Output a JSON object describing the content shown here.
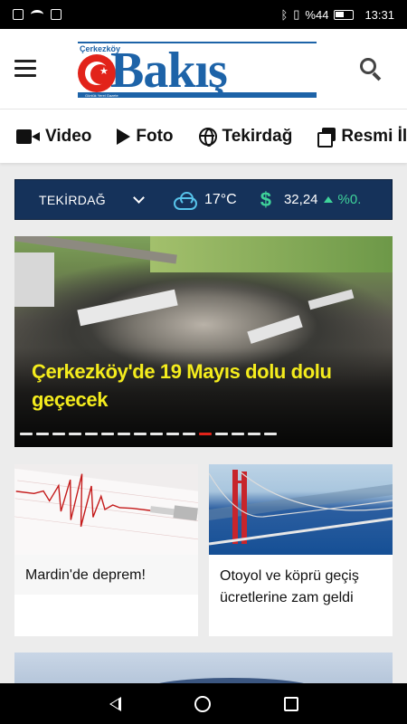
{
  "status_bar": {
    "network_icons": [
      "sim-icon",
      "wifi-icon",
      "nfc-icon"
    ],
    "right_icons": [
      "bluetooth-icon",
      "vibrate-icon"
    ],
    "signal": "%44",
    "time": "13:31"
  },
  "header": {
    "logo": {
      "small_text": "Çerkezköy",
      "name": "Bakış",
      "tagline": "Günlük Yerel Gazete",
      "brand_color": "#1d63a8",
      "accent_color": "#e2231a"
    }
  },
  "categories": [
    {
      "label": "Video",
      "icon": "video-icon"
    },
    {
      "label": "Foto",
      "icon": "play-icon"
    },
    {
      "label": "Tekirdağ",
      "icon": "globe-icon"
    },
    {
      "label": "Resmi İl",
      "icon": "copy-icon"
    }
  ],
  "info_bar": {
    "city": "TEKİRDAĞ",
    "temperature": "17°C",
    "currency_symbol": "$",
    "rate": "32,24",
    "change": "%0."
  },
  "hero": {
    "title": "Çerkezköy'de 19 Mayıs dolu dolu geçecek",
    "slide_count": 16,
    "active_slide": 12
  },
  "cards": [
    {
      "title": "Mardin'de deprem!"
    },
    {
      "title": "Otoyol ve köprü geçiş ücretlerine zam geldi"
    }
  ]
}
